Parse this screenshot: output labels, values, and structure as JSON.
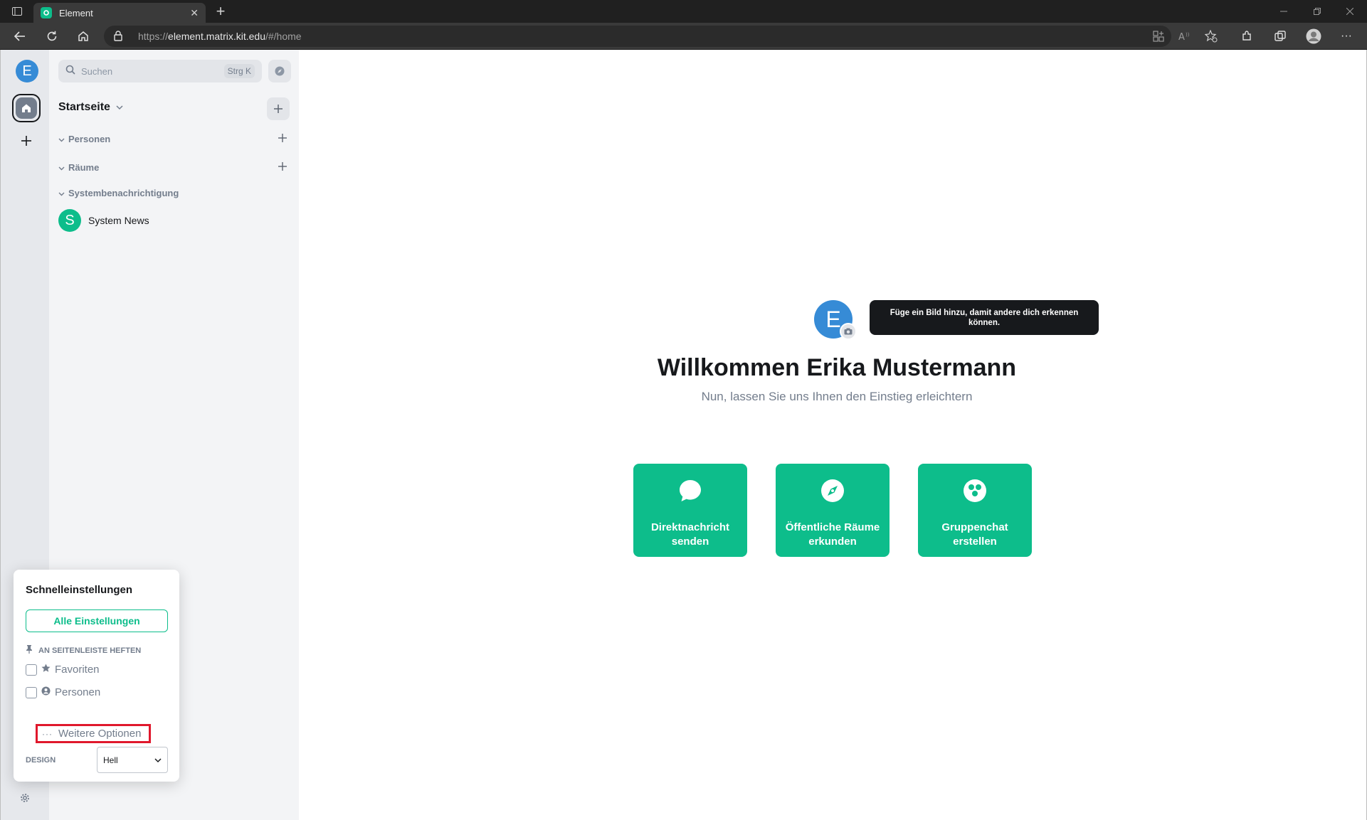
{
  "browser": {
    "tab_title": "Element",
    "url_prefix": "https://",
    "url_host": "element.matrix.kit.edu",
    "url_path": "/#/home"
  },
  "spaces": {
    "user_initial": "E"
  },
  "roomlist": {
    "search_placeholder": "Suchen",
    "search_shortcut": "Strg K",
    "home_title": "Startseite",
    "sections": {
      "people": "Personen",
      "rooms": "Räume",
      "notifications": "Systembenachrichtigung"
    },
    "rooms": [
      {
        "initial": "S",
        "name": "System News"
      }
    ]
  },
  "home": {
    "avatar_initial": "E",
    "tooltip": "Füge ein Bild hinzu, damit andere dich erkennen können.",
    "title": "Willkommen Erika Mustermann",
    "subtitle": "Nun, lassen Sie uns Ihnen den Einstieg erleichtern",
    "cards": [
      {
        "label_line1": "Direktnachricht",
        "label_line2": "senden",
        "icon": "chat-bubble-icon"
      },
      {
        "label_line1": "Öffentliche Räume",
        "label_line2": "erkunden",
        "icon": "compass-icon"
      },
      {
        "label_line1": "Gruppenchat",
        "label_line2": "erstellen",
        "icon": "group-icon"
      }
    ]
  },
  "quick_settings": {
    "title": "Schnelleinstellungen",
    "all_settings": "Alle Einstellungen",
    "pin_heading": "AN SEITENLEISTE HEFTEN",
    "favorites": "Favoriten",
    "people": "Personen",
    "more_options": "Weitere Optionen",
    "design_label": "DESIGN",
    "design_value": "Hell"
  },
  "colors": {
    "accent": "#0dbd8b",
    "avatar": "#368bd6",
    "highlight": "#e0182c"
  }
}
